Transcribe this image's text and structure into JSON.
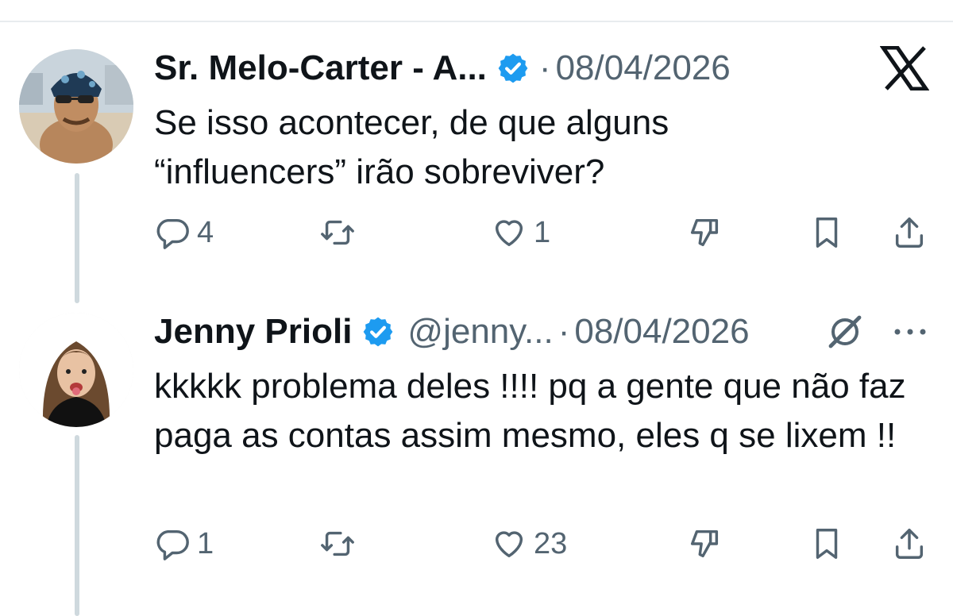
{
  "tweets": [
    {
      "display_name": "Sr. Melo-Carter - A...",
      "handle": "",
      "date": "08/04/2026",
      "text": "Se isso acontecer, de que alguns “influencers” irão sobreviver?",
      "replies": "4",
      "retweets": "",
      "likes": "1",
      "avatar_icon": "man-sunglasses-beach-avatar"
    },
    {
      "display_name": "Jenny Prioli",
      "handle": "@jenny...",
      "date": "08/04/2026",
      "text": "kkkkk problema deles !!!! pq a gente que não faz paga as contas assim mesmo, eles q se lixem !!",
      "replies": "1",
      "retweets": "",
      "likes": "23",
      "avatar_icon": "woman-long-hair-avatar"
    }
  ],
  "dot_separator": "·",
  "colors": {
    "verified": "#1d9bf0",
    "secondary_text": "#536471",
    "primary_text": "#0f1419",
    "thread_line": "#cfd9de"
  },
  "icons": [
    "x-logo-icon",
    "grok-icon",
    "more-icon",
    "reply-icon",
    "retweet-icon",
    "like-icon",
    "dislike-icon",
    "bookmark-icon",
    "share-icon",
    "verified-badge-icon"
  ]
}
